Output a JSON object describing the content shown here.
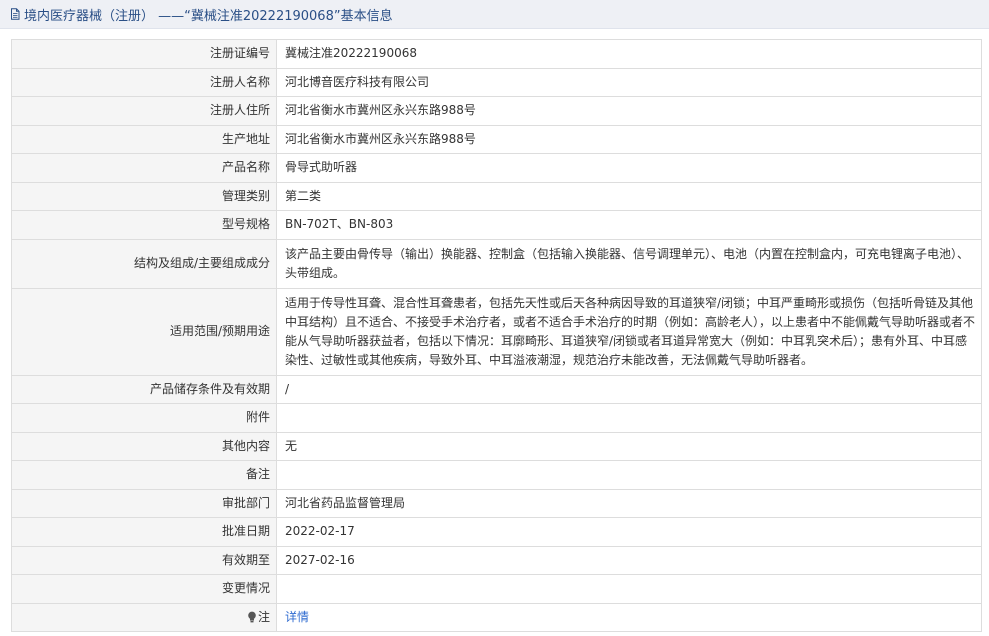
{
  "header": {
    "title": "境内医疗器械（注册） ——“冀械注准20222190068”基本信息",
    "icon": "document-icon"
  },
  "rows": [
    {
      "label": "注册证编号",
      "value": "冀械注准20222190068"
    },
    {
      "label": "注册人名称",
      "value": "河北博音医疗科技有限公司"
    },
    {
      "label": "注册人住所",
      "value": "河北省衡水市冀州区永兴东路988号"
    },
    {
      "label": "生产地址",
      "value": "河北省衡水市冀州区永兴东路988号"
    },
    {
      "label": "产品名称",
      "value": "骨导式助听器"
    },
    {
      "label": "管理类别",
      "value": "第二类"
    },
    {
      "label": "型号规格",
      "value": "BN-702T、BN-803"
    },
    {
      "label": "结构及组成/主要组成成分",
      "value": "该产品主要由骨传导（输出）换能器、控制盒（包括输入换能器、信号调理单元）、电池（内置在控制盒内，可充电锂离子电池）、头带组成。"
    },
    {
      "label": "适用范围/预期用途",
      "value": "适用于传导性耳聋、混合性耳聋患者，包括先天性或后天各种病因导致的耳道狭窄/闭锁；中耳严重畸形或损伤（包括听骨链及其他中耳结构）且不适合、不接受手术治疗者，或者不适合手术治疗的时期（例如：高龄老人），以上患者中不能佩戴气导助听器或者不能从气导助听器获益者，包括以下情况：耳廓畸形、耳道狭窄/闭锁或者耳道异常宽大（例如：中耳乳突术后）；患有外耳、中耳感染性、过敏性或其他疾病，导致外耳、中耳溢液潮湿，规范治疗未能改善，无法佩戴气导助听器者。"
    },
    {
      "label": "产品储存条件及有效期",
      "value": "/"
    },
    {
      "label": "附件",
      "value": ""
    },
    {
      "label": "其他内容",
      "value": "无"
    },
    {
      "label": "备注",
      "value": ""
    },
    {
      "label": "审批部门",
      "value": "河北省药品监督管理局"
    },
    {
      "label": "批准日期",
      "value": "2022-02-17"
    },
    {
      "label": "有效期至",
      "value": "2027-02-16"
    },
    {
      "label": "变更情况",
      "value": ""
    }
  ],
  "note": {
    "label": "注",
    "icon": "lightbulb-icon",
    "link_text": "详情"
  }
}
